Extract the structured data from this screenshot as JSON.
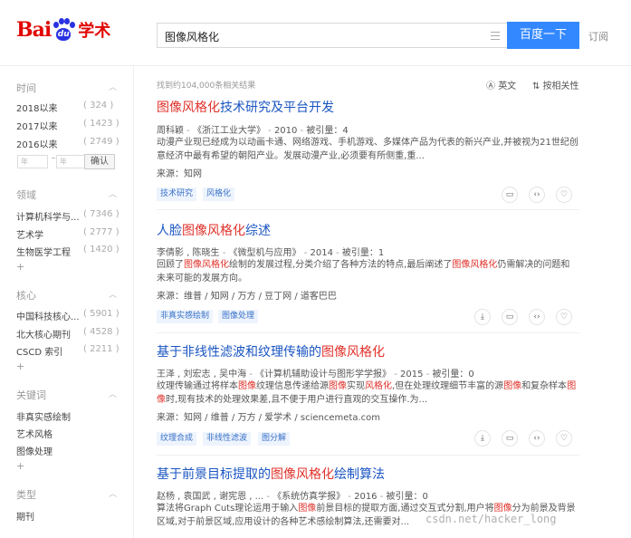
{
  "header": {
    "logo_bai": "Bai",
    "logo_du": "du",
    "logo_xueshu": "学术",
    "search_query": "图像风格化",
    "search_button": "百度一下",
    "subscribe": "订阅"
  },
  "sidebar": {
    "time": {
      "title": "时间",
      "items": [
        {
          "label": "2018以来",
          "count": "( 324 )"
        },
        {
          "label": "2017以来",
          "count": "( 1423 )"
        },
        {
          "label": "2016以来",
          "count": "( 2749 )"
        }
      ],
      "from_placeholder": "年",
      "to_placeholder": "年",
      "confirm": "确认"
    },
    "field": {
      "title": "领域",
      "items": [
        {
          "label": "计算机科学与...",
          "count": "( 7346 )"
        },
        {
          "label": "艺术学",
          "count": "( 2777 )"
        },
        {
          "label": "生物医学工程",
          "count": "( 1420 )"
        }
      ],
      "more": "+"
    },
    "core": {
      "title": "核心",
      "items": [
        {
          "label": "中国科技核心...",
          "count": "( 5901 )"
        },
        {
          "label": "北大核心期刊",
          "count": "( 4528 )"
        },
        {
          "label": "CSCD 索引",
          "count": "( 2211 )"
        }
      ],
      "more": "+"
    },
    "keywords": {
      "title": "关键词",
      "items": [
        {
          "label": "非真实感绘制"
        },
        {
          "label": "艺术风格"
        },
        {
          "label": "图像处理"
        }
      ],
      "more": "+"
    },
    "type": {
      "title": "类型",
      "items": [
        {
          "label": "期刊"
        }
      ]
    }
  },
  "results_meta": {
    "count_text": "找到约104,000条相关结果",
    "english": "英文",
    "sort": "按相关性"
  },
  "results": [
    {
      "title_hl": "图像风格化",
      "title_rest": "技术研究及平台开发",
      "authors": "周科颖",
      "source": "《浙江工业大学》",
      "year": "2010",
      "cited": "被引量：4",
      "abstract": "动漫产业现已经成为以动画卡通、网络游戏、手机游戏、多媒体产品为代表的新兴产业,并被视为21世纪创意经济中最有希望的朝阳产业。发展动漫产业,必须要有所侧重,重...",
      "from": "来源：知网",
      "tags": [
        "技术研究",
        "风格化"
      ]
    },
    {
      "title_pre": "人脸",
      "title_hl": "图像风格化",
      "title_rest": "综述",
      "authors": "李倩影 , 陈晓生",
      "source": "《微型机与应用》",
      "year": "2014",
      "cited": "被引量：1",
      "abstract_a": "回顾了",
      "abstract_hl1": "图像风格化",
      "abstract_b": "绘制的发展过程,分类介绍了各种方法的特点,最后阐述了",
      "abstract_hl2": "图像风格化",
      "abstract_c": "仍需解决的问题和未来可能的发展方向。",
      "from": "来源：维普 / 知网 / 万方 / 豆丁网 / 道客巴巴",
      "tags": [
        "非真实感绘制",
        "图像处理"
      ]
    },
    {
      "title_pre": "基于非线性滤波和纹理传输的",
      "title_hl": "图像风格化",
      "authors": "王泽 , 刘宏志 , 吴中海",
      "source": "《计算机辅助设计与图形学学报》",
      "year": "2015",
      "cited": "被引量：0",
      "abstract_a": "纹理传输通过将样本",
      "abstract_hl1": "图像",
      "abstract_b": "纹理信息传递给源",
      "abstract_hl2": "图像",
      "abstract_c": "实现",
      "abstract_hl3": "风格化",
      "abstract_d": ",但在处理纹理细节丰富的源",
      "abstract_hl4": "图像",
      "abstract_e": "和复杂样本",
      "abstract_hl5": "图像",
      "abstract_f": "时,现有技术的处理效果差,且不便于用户进行直观的交互操作.为...",
      "from": "来源：知网 / 维普 / 万方 / 爱学术 / sciencemeta.com",
      "tags": [
        "纹理合成",
        "非线性滤波",
        "图分解"
      ]
    },
    {
      "title_pre": "基于前景目标提取的",
      "title_hl": "图像风格化",
      "title_rest": "绘制算法",
      "authors": "赵杨 , 袁国武 , 谢宪恩 , ...",
      "source": "《系统仿真学报》",
      "year": "2016",
      "cited": "被引量：0",
      "abstract_a": "算法将Graph Cuts理论运用于输入",
      "abstract_hl1": "图像",
      "abstract_b": "前景目标的提取方面,通过交互式分割,用户将",
      "abstract_hl2": "图像",
      "abstract_c": "分为前景及背景区域,对于前景区域,应用设计的各种艺术感绘制算法,还需要对...",
      "from": "",
      "tags": []
    }
  ],
  "watermark": "csdn.net/hacker_long",
  "colors": {
    "accent": "#3388ff",
    "link": "#1a55c2",
    "highlight": "#e0312a",
    "brand_red": "#e10602",
    "brand_blue": "#2932e1"
  }
}
